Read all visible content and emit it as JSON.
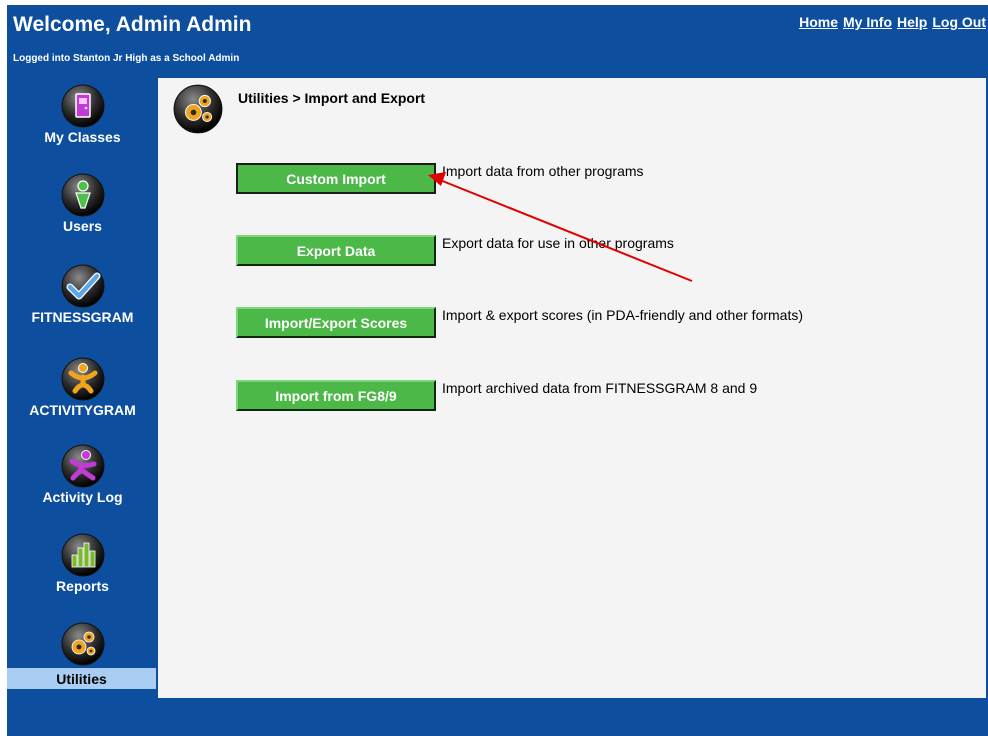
{
  "header": {
    "title": "Welcome, Admin Admin",
    "subtitle": "Logged into Stanton Jr High as a School Admin"
  },
  "top_nav": {
    "home": "Home",
    "my_info": "My Info",
    "help": "Help",
    "log_out": "Log Out"
  },
  "sidebar": {
    "items": [
      {
        "label": "My Classes",
        "icon": "door-icon",
        "color": "#c23bd6"
      },
      {
        "label": "Users",
        "icon": "person-icon",
        "color": "#4cc14a"
      },
      {
        "label": "FITNESSGRAM",
        "icon": "checkmark-icon",
        "color": "#5aa8ea"
      },
      {
        "label": "ACTIVITYGRAM",
        "icon": "activity-figure-icon",
        "color": "#f0a51c"
      },
      {
        "label": "Activity Log",
        "icon": "runner-figure-icon",
        "color": "#c23bd6"
      },
      {
        "label": "Reports",
        "icon": "bar-chart-icon",
        "color": "#7ab82e"
      },
      {
        "label": "Utilities",
        "icon": "gears-icon",
        "color": "#f0a51c"
      }
    ],
    "active": "Utilities"
  },
  "content": {
    "breadcrumb": "Utilities > Import and Export",
    "actions": [
      {
        "label": "Custom Import",
        "description": "Import data from other programs"
      },
      {
        "label": "Export Data",
        "description": "Export data for use in other programs"
      },
      {
        "label": "Import/Export Scores",
        "description": "Import & export scores (in PDA-friendly and other formats)"
      },
      {
        "label": "Import from FG8/9",
        "description": "Import archived data from FITNESSGRAM 8 and 9"
      }
    ]
  },
  "colors": {
    "app_background": "#0d4f9e",
    "content_background": "#f4f4f4",
    "button_green": "#4cb848",
    "active_nav": "#a9cdf3",
    "annotation_arrow": "#e00000"
  }
}
